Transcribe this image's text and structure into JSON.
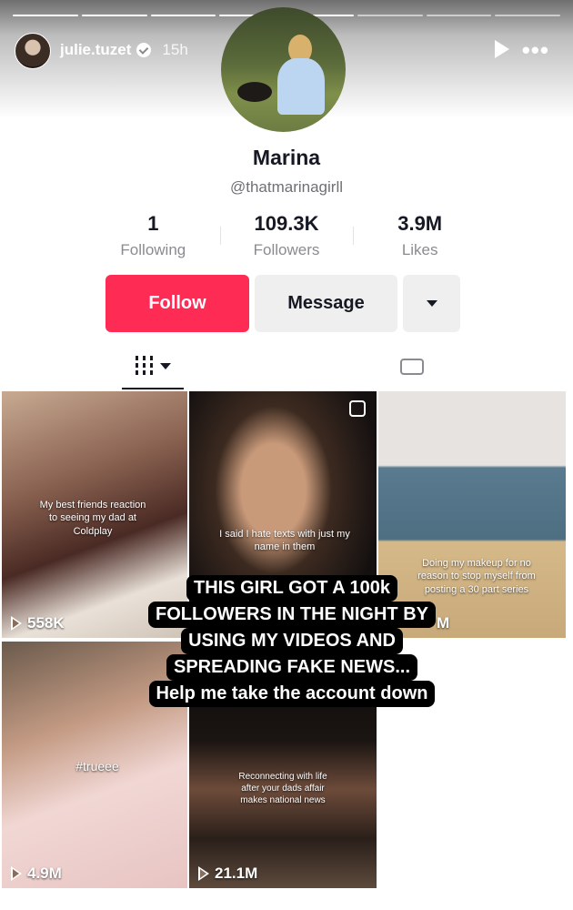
{
  "story": {
    "username": "julie.tuzet",
    "time": "15h",
    "progress_segments": 8,
    "progress_done": 5
  },
  "profile": {
    "name": "Marina",
    "handle": "@thatmarinagirll",
    "stats": [
      {
        "value": "1",
        "label": "Following"
      },
      {
        "value": "109.3K",
        "label": "Followers"
      },
      {
        "value": "3.9M",
        "label": "Likes"
      }
    ],
    "follow_label": "Follow",
    "message_label": "Message",
    "accent": "#fe2c55"
  },
  "videos": [
    {
      "overlay": "My best friends reaction to seeing my dad at Coldplay",
      "views": "558K"
    },
    {
      "overlay": "I said I hate texts with just my name in them",
      "views": ""
    },
    {
      "overlay": "Doing my makeup for no reason to stop myself from posting a 30 part series",
      "views": "M"
    },
    {
      "overlay": "#trueee",
      "views": "4.9M"
    },
    {
      "overlay": "Reconnecting with life after your dads affair makes national news",
      "views": "21.1M"
    }
  ],
  "caption_lines": [
    "THIS GIRL GOT A 100k",
    "FOLLOWERS IN THE NIGHT BY",
    "USING MY VIDEOS AND",
    "SPREADING FAKE NEWS...",
    "Help me take the account down"
  ]
}
